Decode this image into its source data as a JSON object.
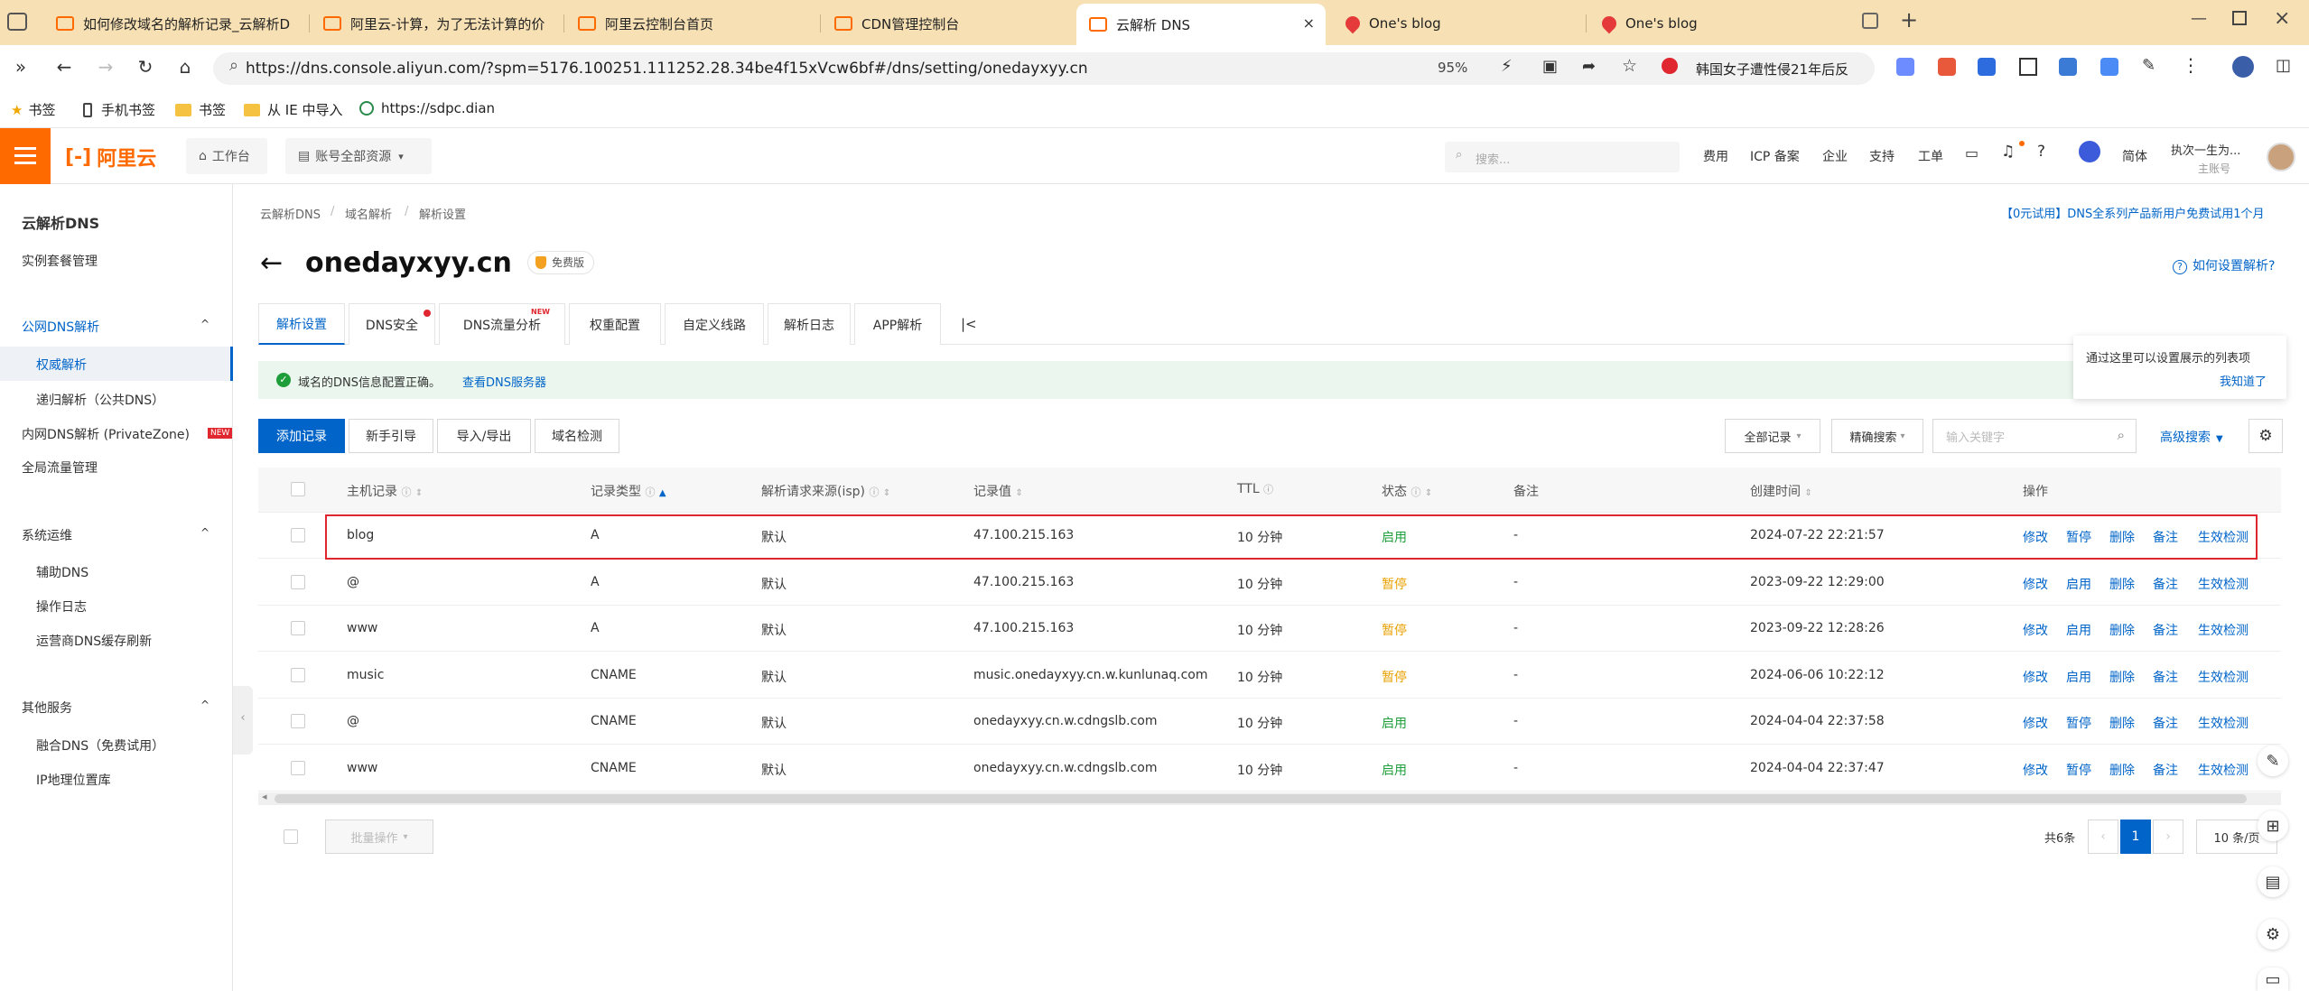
{
  "browser": {
    "tabs": [
      {
        "title": "如何修改域名的解析记录_云解析D"
      },
      {
        "title": "阿里云-计算，为了无法计算的价"
      },
      {
        "title": "阿里云控制台首页"
      },
      {
        "title": "CDN管理控制台"
      },
      {
        "title": "云解析 DNS",
        "close": "×"
      },
      {
        "title": "One's blog"
      },
      {
        "title": "One's blog"
      }
    ],
    "new_tab": "+",
    "url": "https://dns.console.aliyun.com/?spm=5176.100251.111252.28.34be4f15xVcw6bf#/dns/setting/onedayxyy.cn",
    "zoom": "95%",
    "search_suggest": "韩国女子遭性侵21年后反",
    "bookmarks": [
      "书签",
      "手机书签",
      "书签",
      "从 IE 中导入",
      "https://sdpc.dian"
    ]
  },
  "header": {
    "logo": "阿里云",
    "workbench": "工作台",
    "resources": "账号全部资源",
    "search_placeholder": "搜索...",
    "links": [
      "费用",
      "ICP 备案",
      "企业",
      "支持",
      "工单"
    ],
    "lang": "简体",
    "user_name": "执次一生为...",
    "user_role": "主账号"
  },
  "sidebar": {
    "title": "云解析DNS",
    "items": [
      {
        "label": "实例套餐管理"
      },
      {
        "label": "公网DNS解析"
      },
      {
        "label": "权威解析"
      },
      {
        "label": "递归解析（公共DNS）"
      },
      {
        "label": "内网DNS解析 (PrivateZone)",
        "badge": "NEW"
      },
      {
        "label": "全局流量管理"
      },
      {
        "label": "系统运维"
      },
      {
        "label": "辅助DNS"
      },
      {
        "label": "操作日志"
      },
      {
        "label": "运营商DNS缓存刷新"
      },
      {
        "label": "其他服务"
      },
      {
        "label": "融合DNS（免费试用）"
      },
      {
        "label": "IP地理位置库"
      }
    ]
  },
  "breadcrumb": [
    "云解析DNS",
    "/",
    "域名解析",
    "/",
    "解析设置"
  ],
  "promo": "【0元试用】DNS全系列产品新用户免费试用1个月",
  "domain": "onedayxyy.cn",
  "edition": "免费版",
  "help_link": "如何设置解析?",
  "tabs": [
    "解析设置",
    "DNS安全",
    "DNS流量分析",
    "权重配置",
    "自定义线路",
    "解析日志",
    "APP解析"
  ],
  "tab_badge_new": "NEW",
  "collapse_glyph": "|<",
  "notice": {
    "text": "域名的DNS信息配置正确。",
    "link": "查看DNS服务器"
  },
  "tooltip": {
    "text": "通过这里可以设置展示的列表项",
    "link": "我知道了"
  },
  "toolbar": {
    "add": "添加记录",
    "guide": "新手引导",
    "import_export": "导入/导出",
    "check": "域名检测",
    "all_records": "全部记录",
    "exact": "精确搜索",
    "keyword_placeholder": "输入关键字",
    "advanced": "高级搜索"
  },
  "table": {
    "headers": [
      "主机记录",
      "记录类型",
      "解析请求来源(isp)",
      "记录值",
      "TTL",
      "状态",
      "备注",
      "创建时间",
      "操作"
    ],
    "rows": [
      {
        "host": "blog",
        "type": "A",
        "isp": "默认",
        "value": "47.100.215.163",
        "ttl": "10 分钟",
        "status": "启用",
        "remark": "-",
        "created": "2024-07-22 22:21:57",
        "ops": [
          "修改",
          "暂停",
          "删除",
          "备注",
          "生效检测"
        ]
      },
      {
        "host": "@",
        "type": "A",
        "isp": "默认",
        "value": "47.100.215.163",
        "ttl": "10 分钟",
        "status": "暂停",
        "remark": "-",
        "created": "2023-09-22 12:29:00",
        "ops": [
          "修改",
          "启用",
          "删除",
          "备注",
          "生效检测"
        ]
      },
      {
        "host": "www",
        "type": "A",
        "isp": "默认",
        "value": "47.100.215.163",
        "ttl": "10 分钟",
        "status": "暂停",
        "remark": "-",
        "created": "2023-09-22 12:28:26",
        "ops": [
          "修改",
          "启用",
          "删除",
          "备注",
          "生效检测"
        ]
      },
      {
        "host": "music",
        "type": "CNAME",
        "isp": "默认",
        "value": "music.onedayxyy.cn.w.kunlunaq.com",
        "ttl": "10 分钟",
        "status": "暂停",
        "remark": "-",
        "created": "2024-06-06 10:22:12",
        "ops": [
          "修改",
          "启用",
          "删除",
          "备注",
          "生效检测"
        ]
      },
      {
        "host": "@",
        "type": "CNAME",
        "isp": "默认",
        "value": "onedayxyy.cn.w.cdngslb.com",
        "ttl": "10 分钟",
        "status": "启用",
        "remark": "-",
        "created": "2024-04-04 22:37:58",
        "ops": [
          "修改",
          "暂停",
          "删除",
          "备注",
          "生效检测"
        ]
      },
      {
        "host": "www",
        "type": "CNAME",
        "isp": "默认",
        "value": "onedayxyy.cn.w.cdngslb.com",
        "ttl": "10 分钟",
        "status": "启用",
        "remark": "-",
        "created": "2024-04-04 22:37:47",
        "ops": [
          "修改",
          "暂停",
          "删除",
          "备注",
          "生效检测"
        ]
      }
    ]
  },
  "footer": {
    "batch": "批量操作",
    "total": "共6条",
    "page": "1",
    "page_size": "10 条/页"
  },
  "colors": {
    "accent": "#0064c8",
    "brand": "#ff6a00",
    "enabled": "#1e9e3a",
    "paused": "#e9a000",
    "highlight": "#e0262e"
  }
}
